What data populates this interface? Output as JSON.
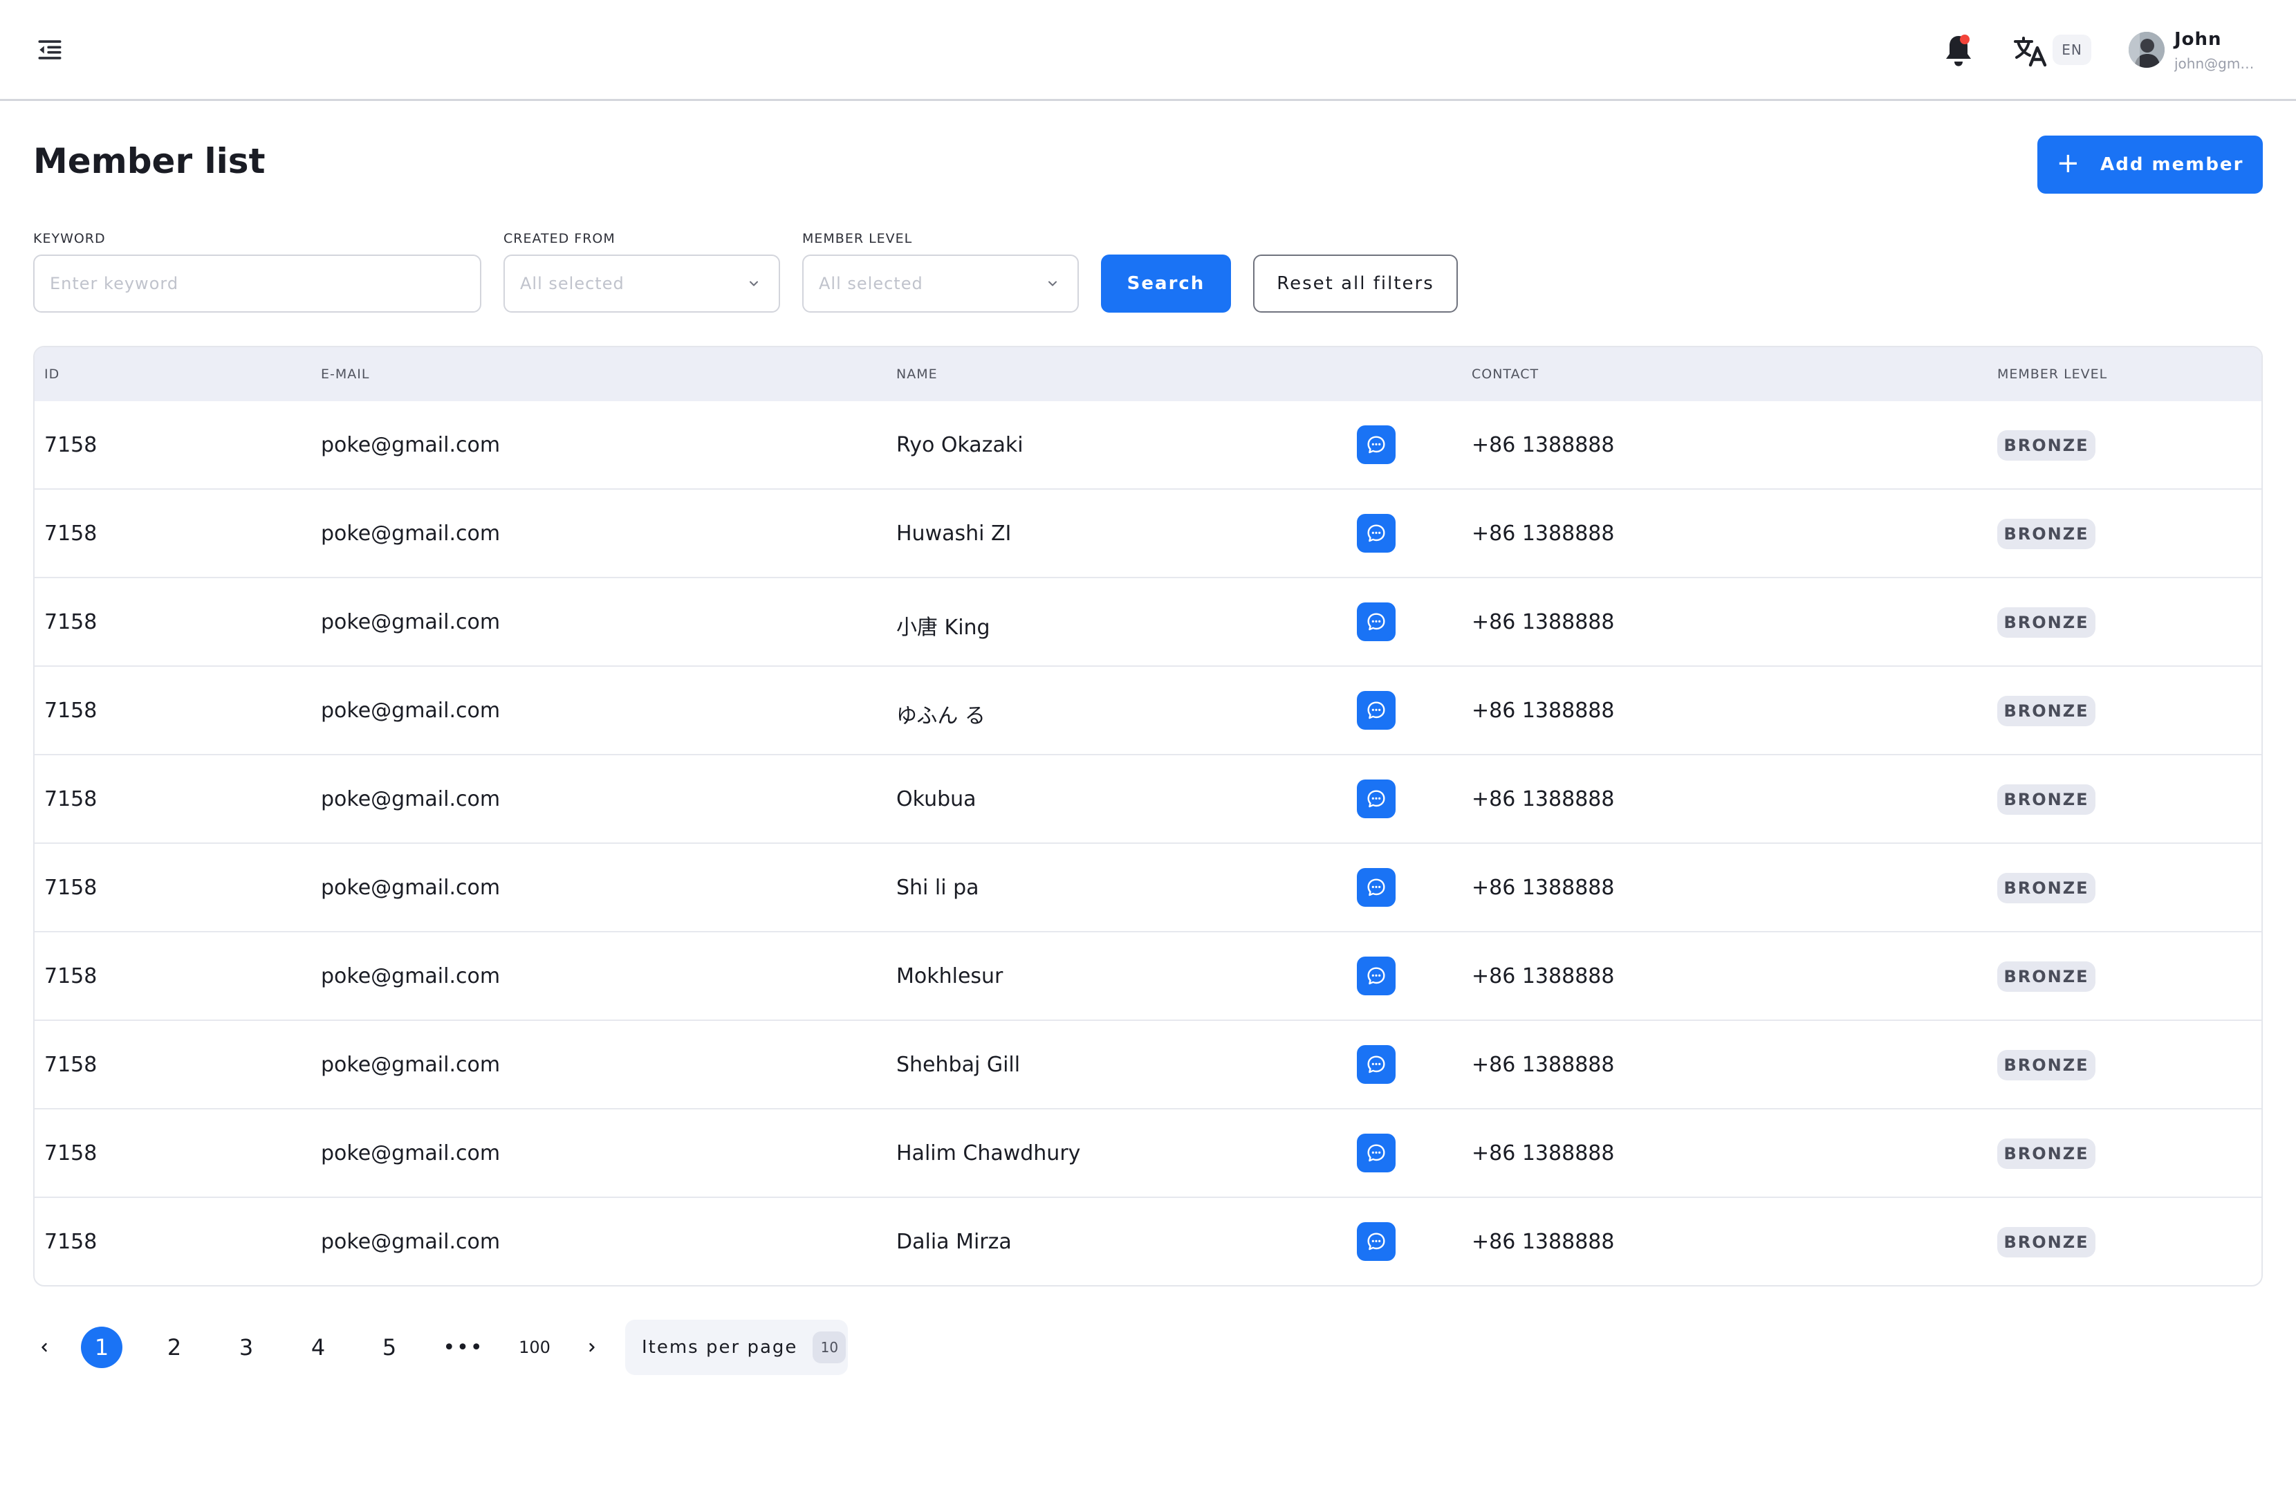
{
  "header": {
    "language": "EN",
    "user": {
      "name": "John",
      "email": "john@gmail.com"
    }
  },
  "page": {
    "title": "Member list",
    "add_button": "Add member"
  },
  "filters": {
    "keyword": {
      "label": "KEYWORD",
      "placeholder": "Enter keyword"
    },
    "created_from": {
      "label": "CREATED FROM",
      "value": "All selected"
    },
    "member_level": {
      "label": "MEMBER LEVEL",
      "value": "All selected"
    },
    "search_button": "Search",
    "reset_button": "Reset all filters"
  },
  "table": {
    "columns": [
      "ID",
      "E-MAIL",
      "NAME",
      "CONTACT",
      "MEMBER LEVEL"
    ],
    "rows": [
      {
        "id": "7158",
        "email": "poke@gmail.com",
        "name": "Ryo Okazaki",
        "contact": "+86 1388888",
        "level": "BRONZE"
      },
      {
        "id": "7158",
        "email": "poke@gmail.com",
        "name": "Huwashi ZI",
        "contact": "+86 1388888",
        "level": "BRONZE"
      },
      {
        "id": "7158",
        "email": "poke@gmail.com",
        "name": "小唐 King",
        "contact": "+86 1388888",
        "level": "BRONZE"
      },
      {
        "id": "7158",
        "email": "poke@gmail.com",
        "name": "ゆふん る",
        "contact": "+86 1388888",
        "level": "BRONZE"
      },
      {
        "id": "7158",
        "email": "poke@gmail.com",
        "name": "Okubua",
        "contact": "+86 1388888",
        "level": "BRONZE"
      },
      {
        "id": "7158",
        "email": "poke@gmail.com",
        "name": "Shi li pa",
        "contact": "+86 1388888",
        "level": "BRONZE"
      },
      {
        "id": "7158",
        "email": "poke@gmail.com",
        "name": "Mokhlesur",
        "contact": "+86 1388888",
        "level": "BRONZE"
      },
      {
        "id": "7158",
        "email": "poke@gmail.com",
        "name": "Shehbaj Gill",
        "contact": "+86 1388888",
        "level": "BRONZE"
      },
      {
        "id": "7158",
        "email": "poke@gmail.com",
        "name": "Halim Chawdhury",
        "contact": "+86 1388888",
        "level": "BRONZE"
      },
      {
        "id": "7158",
        "email": "poke@gmail.com",
        "name": "Dalia Mirza",
        "contact": "+86 1388888",
        "level": "BRONZE"
      }
    ]
  },
  "pagination": {
    "pages": [
      "1",
      "2",
      "3",
      "4",
      "5"
    ],
    "current": "1",
    "ellipsis": "•••",
    "last": "100",
    "items_per_page_label": "Items per page",
    "items_per_page": "10"
  },
  "colors": {
    "accent": "#1a73f5",
    "header_row": "#eceef6",
    "badge_bg": "#e6e8f0",
    "notification_dot": "#f3443a"
  },
  "icons": [
    "menu-collapse-icon",
    "bell-icon",
    "translate-icon",
    "chevron-down-icon",
    "chat-icon",
    "plus-icon",
    "chevron-left-icon",
    "chevron-right-icon"
  ]
}
